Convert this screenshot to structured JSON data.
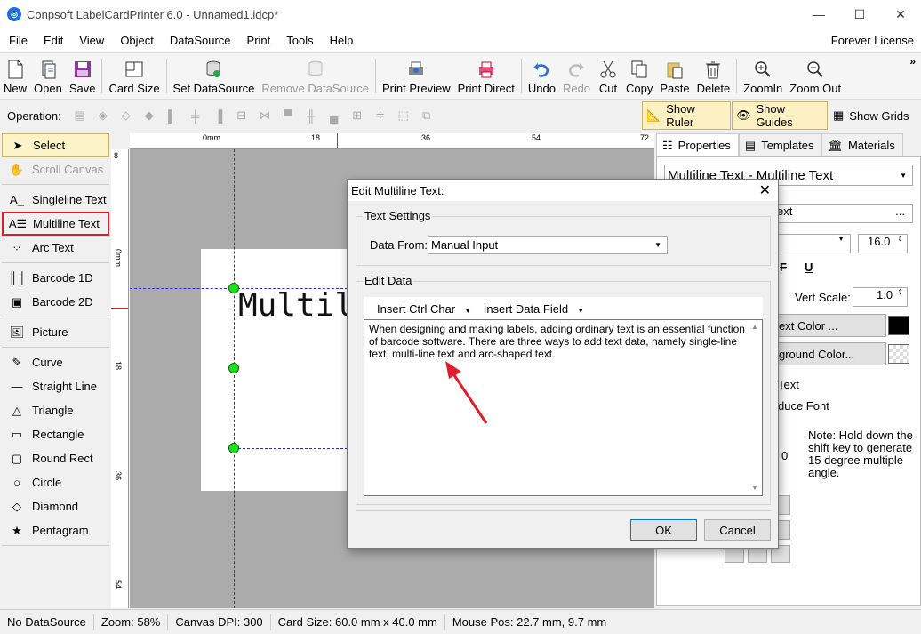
{
  "app": {
    "title": "Conpsoft LabelCardPrinter 6.0 - Unnamed1.idcp*"
  },
  "menu": {
    "items": [
      "File",
      "Edit",
      "View",
      "Object",
      "DataSource",
      "Print",
      "Tools",
      "Help"
    ],
    "license": "Forever License"
  },
  "toolbar": {
    "new": "New",
    "open": "Open",
    "save": "Save",
    "card_size": "Card Size",
    "set_ds": "Set DataSource",
    "remove_ds": "Remove DataSource",
    "print_preview": "Print Preview",
    "print_direct": "Print Direct",
    "undo": "Undo",
    "redo": "Redo",
    "cut": "Cut",
    "copy": "Copy",
    "paste": "Paste",
    "delete": "Delete",
    "zoom_in": "ZoomIn",
    "zoom_out": "Zoom Out",
    "more": "»"
  },
  "opbar": {
    "label": "Operation:",
    "show_ruler": "Show Ruler",
    "show_guides": "Show Guides",
    "show_grids": "Show Grids"
  },
  "tools": {
    "select": "Select",
    "scroll": "Scroll Canvas",
    "singleline": "Singleline Text",
    "multiline": "Multiline Text",
    "arc": "Arc Text",
    "barcode1d": "Barcode 1D",
    "barcode2d": "Barcode 2D",
    "picture": "Picture",
    "curve": "Curve",
    "line": "Straight Line",
    "triangle": "Triangle",
    "rectangle": "Rectangle",
    "roundrect": "Round Rect",
    "circle": "Circle",
    "diamond": "Diamond",
    "pentagram": "Pentagram"
  },
  "ruler": {
    "top": [
      "0mm",
      "18",
      "36",
      "54",
      "72"
    ],
    "left": [
      "0mm",
      "18",
      "36",
      "54"
    ],
    "left_top": "8"
  },
  "canvas": {
    "text": "Multil"
  },
  "props": {
    "tabs": [
      "Properties",
      "Templates",
      "Materials"
    ],
    "object_select": "Multiline Text - Multiline Text",
    "text_field": "ext",
    "text_field_btn": "...",
    "font_size": "16.0",
    "style_strike": "F",
    "style_underline": "U",
    "vert_scale_label": "Vert Scale:",
    "vert_scale": "1.0",
    "text_color_btn": "ext Color ...",
    "bg_color_btn": "ground Color...",
    "text_check": "Text",
    "reduce_font": "duce Font",
    "zero": "0",
    "note": "Note: Hold down the shift key to generate 15 degree multiple angle."
  },
  "dialog": {
    "title": "Edit Multiline Text:",
    "text_settings": "Text Settings",
    "data_from_label": "Data From:",
    "data_from_value": "Manual Input",
    "edit_data": "Edit Data",
    "insert_ctrl": "Insert Ctrl Char",
    "insert_field": "Insert Data Field",
    "content": "When designing and making labels, adding ordinary text is an essential function of barcode software. There are three ways to add text data, namely single-line text, multi-line text and arc-shaped text.",
    "ok": "OK",
    "cancel": "Cancel"
  },
  "status": {
    "ds": "No DataSource",
    "zoom": "Zoom: 58%",
    "dpi": "Canvas DPI: 300",
    "card": "Card Size: 60.0 mm x 40.0 mm",
    "mouse": "Mouse Pos: 22.7 mm, 9.7 mm"
  },
  "colors": {
    "accent": "#0078d7",
    "highlight": "#e11d2c",
    "handle": "#1ee01e"
  }
}
